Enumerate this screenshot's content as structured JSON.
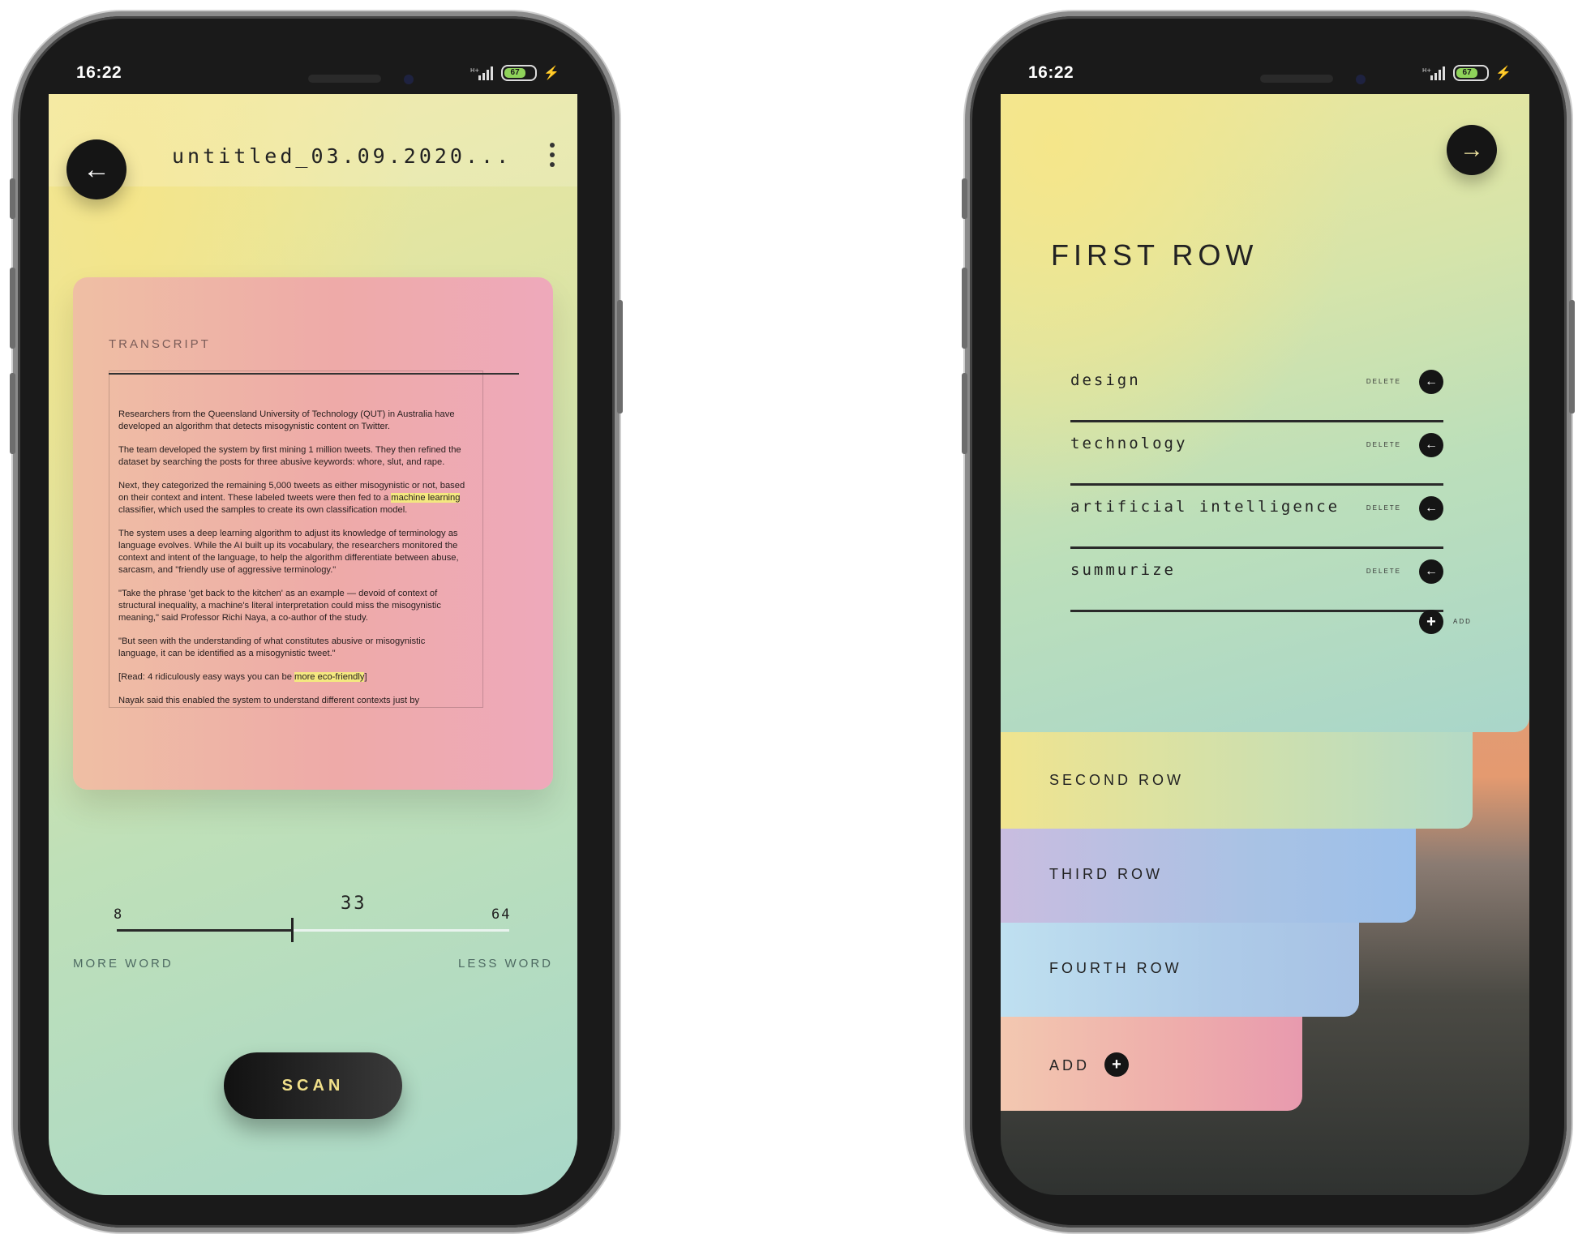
{
  "left": {
    "status": {
      "time": "16:22",
      "battery": "67"
    },
    "header": {
      "back_icon": "←",
      "title": "untitled_03.09.2020...",
      "menu_icon": "kebab-icon"
    },
    "card": {
      "label": "TRANSCRIPT",
      "paragraphs": [
        "Researchers from the Queensland University of Technology (QUT) in Australia have developed an algorithm that detects misogynistic content on Twitter.",
        "The team developed the system by first mining 1 million tweets. They then refined the dataset by searching the posts for three abusive keywords: whore, slut, and rape.",
        "Next, they categorized the remaining 5,000 tweets as either misogynistic or not, based on their context and intent. These labeled tweets were then fed to a ",
        "The system uses a deep learning algorithm to adjust its knowledge of terminology as language evolves. While the AI built up its vocabulary, the researchers monitored the context and intent of the language, to help the algorithm differentiate between abuse, sarcasm, and \"friendly use of aggressive terminology.\"",
        "\"Take the phrase 'get back to the kitchen' as an example — devoid of context of structural inequality, a machine's literal interpretation could miss the misogynistic meaning,\" said Professor Richi Naya, a co-author of the study.",
        "\"But seen with the understanding of what constitutes abusive or misogynistic language, it can be identified as a misogynistic tweet.\"",
        "[Read: 4 ridiculously easy ways you can be ",
        "Nayak said this enabled the system to understand different contexts just by"
      ],
      "p3_highlight": "machine learning",
      "p3_tail": " classifier, which used the samples to create its own classification model.",
      "p7_highlight": "more eco-friendly",
      "p7_tail": "]"
    },
    "slider": {
      "min": "8",
      "value": "33",
      "max": "64",
      "value_fraction": 0.446,
      "left_label": "MORE WORD",
      "right_label": "LESS WORD"
    },
    "scan_label": "SCAN"
  },
  "right": {
    "status": {
      "time": "16:22",
      "battery": "67"
    },
    "forward_icon": "→",
    "first_row": {
      "title": "FIRST ROW",
      "items": [
        {
          "label": "design",
          "delete": "DELETE"
        },
        {
          "label": "technology",
          "delete": "DELETE"
        },
        {
          "label": "artificial intelligence",
          "delete": "DELETE"
        },
        {
          "label": "summurize",
          "delete": "DELETE"
        }
      ],
      "add_label": "ADD"
    },
    "rows": {
      "second": "SECOND ROW",
      "third": "THIRD ROW",
      "fourth": "FOURTH ROW",
      "add": "ADD"
    },
    "colors": {
      "accent_dark": "#151515",
      "scan_text": "#f1e08a"
    }
  }
}
